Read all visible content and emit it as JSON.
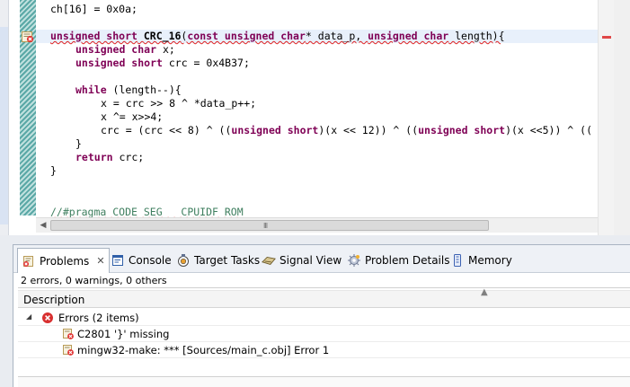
{
  "editor": {
    "lines": [
      {
        "kind": "plain",
        "text": "ch[16] = 0x0a;"
      },
      {
        "kind": "blank",
        "text": ""
      },
      {
        "kind": "func_signature",
        "kw1": "unsigned short",
        "name": "CRC_16",
        "rest1": "(",
        "kw2": "const unsigned char",
        "rest2": "* data_p, ",
        "kw3": "unsigned char",
        "rest3": " length){"
      },
      {
        "kind": "decl",
        "kw": "unsigned char",
        "rest": " x;"
      },
      {
        "kind": "decl",
        "kw": "unsigned short",
        "rest": " crc = 0x4B37;"
      },
      {
        "kind": "blank",
        "text": ""
      },
      {
        "kind": "while",
        "kw": "while",
        "rest": " (length--){"
      },
      {
        "kind": "plain",
        "text": "x = crc >> 8 ^ *data_p++;"
      },
      {
        "kind": "plain",
        "text": "x ^= x>>4;"
      },
      {
        "kind": "crc_expr",
        "p1": "crc = (crc << 8) ^ ((",
        "kw1": "unsigned short",
        "p2": ")(x << 12)) ^ ((",
        "kw2": "unsigned short",
        "p3": ")(x <<5)) ^ (("
      },
      {
        "kind": "plain",
        "text": "}"
      },
      {
        "kind": "return",
        "kw": "return",
        "rest": " crc;"
      },
      {
        "kind": "plain",
        "text": "}"
      },
      {
        "kind": "blank",
        "text": ""
      },
      {
        "kind": "blank",
        "text": ""
      },
      {
        "kind": "comment",
        "text": "//#pragma CODE_SEG   CPUIDF_ROM"
      }
    ],
    "scrollbar_grip": "III"
  },
  "panel": {
    "tabs": [
      {
        "label": "Problems",
        "icon": "problems-icon",
        "active": true,
        "close": "✕"
      },
      {
        "label": "Console",
        "icon": "console-icon"
      },
      {
        "label": "Target Tasks",
        "icon": "target-tasks-icon"
      },
      {
        "label": "Signal View",
        "icon": "signal-view-icon"
      },
      {
        "label": "Problem Details",
        "icon": "problem-details-icon"
      },
      {
        "label": "Memory",
        "icon": "memory-icon"
      }
    ],
    "summary": "2 errors, 0 warnings, 0 others",
    "table": {
      "column": "Description",
      "group": {
        "label": "Errors (2 items)",
        "expanded": true
      },
      "items": [
        {
          "description": "C2801 '}' missing"
        },
        {
          "description": "mingw32-make: *** [Sources/main_c.obj] Error 1"
        }
      ]
    }
  },
  "colors": {
    "keyword": "#7f0055",
    "comment": "#3f7f5f",
    "error": "#e02020",
    "current_line": "#e8f0fb"
  }
}
